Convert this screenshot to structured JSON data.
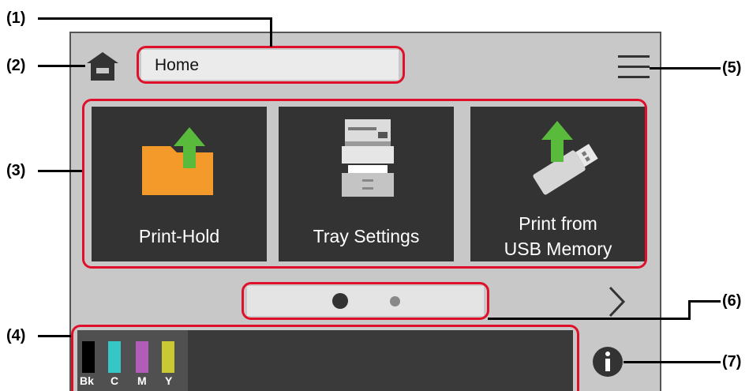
{
  "callouts": {
    "c1": "(1)",
    "c2": "(2)",
    "c3": "(3)",
    "c4": "(4)",
    "c5": "(5)",
    "c6": "(6)",
    "c7": "(7)"
  },
  "header": {
    "title": "Home",
    "home_icon": "home-icon",
    "menu_icon": "hamburger-menu-icon"
  },
  "tiles": [
    {
      "label_line1": "Print-Hold",
      "label_line2": "",
      "icon": "folder-upload-icon"
    },
    {
      "label_line1": "Tray Settings",
      "label_line2": "",
      "icon": "printer-icon"
    },
    {
      "label_line1": "Print from",
      "label_line2": "USB Memory",
      "icon": "usb-upload-icon"
    }
  ],
  "pager": {
    "pages": 2,
    "current": 1,
    "next_icon": "chevron-right-icon"
  },
  "toner": [
    {
      "label": "Bk",
      "color": "#000000"
    },
    {
      "label": "C",
      "color": "#35c6c6"
    },
    {
      "label": "M",
      "color": "#b05cb8"
    },
    {
      "label": "Y",
      "color": "#c9c934"
    }
  ],
  "info_icon": "info-icon",
  "colors": {
    "highlight": "#e0102a",
    "folder": "#f39a2b",
    "arrow": "#5aba3b",
    "tile": "#333333"
  }
}
